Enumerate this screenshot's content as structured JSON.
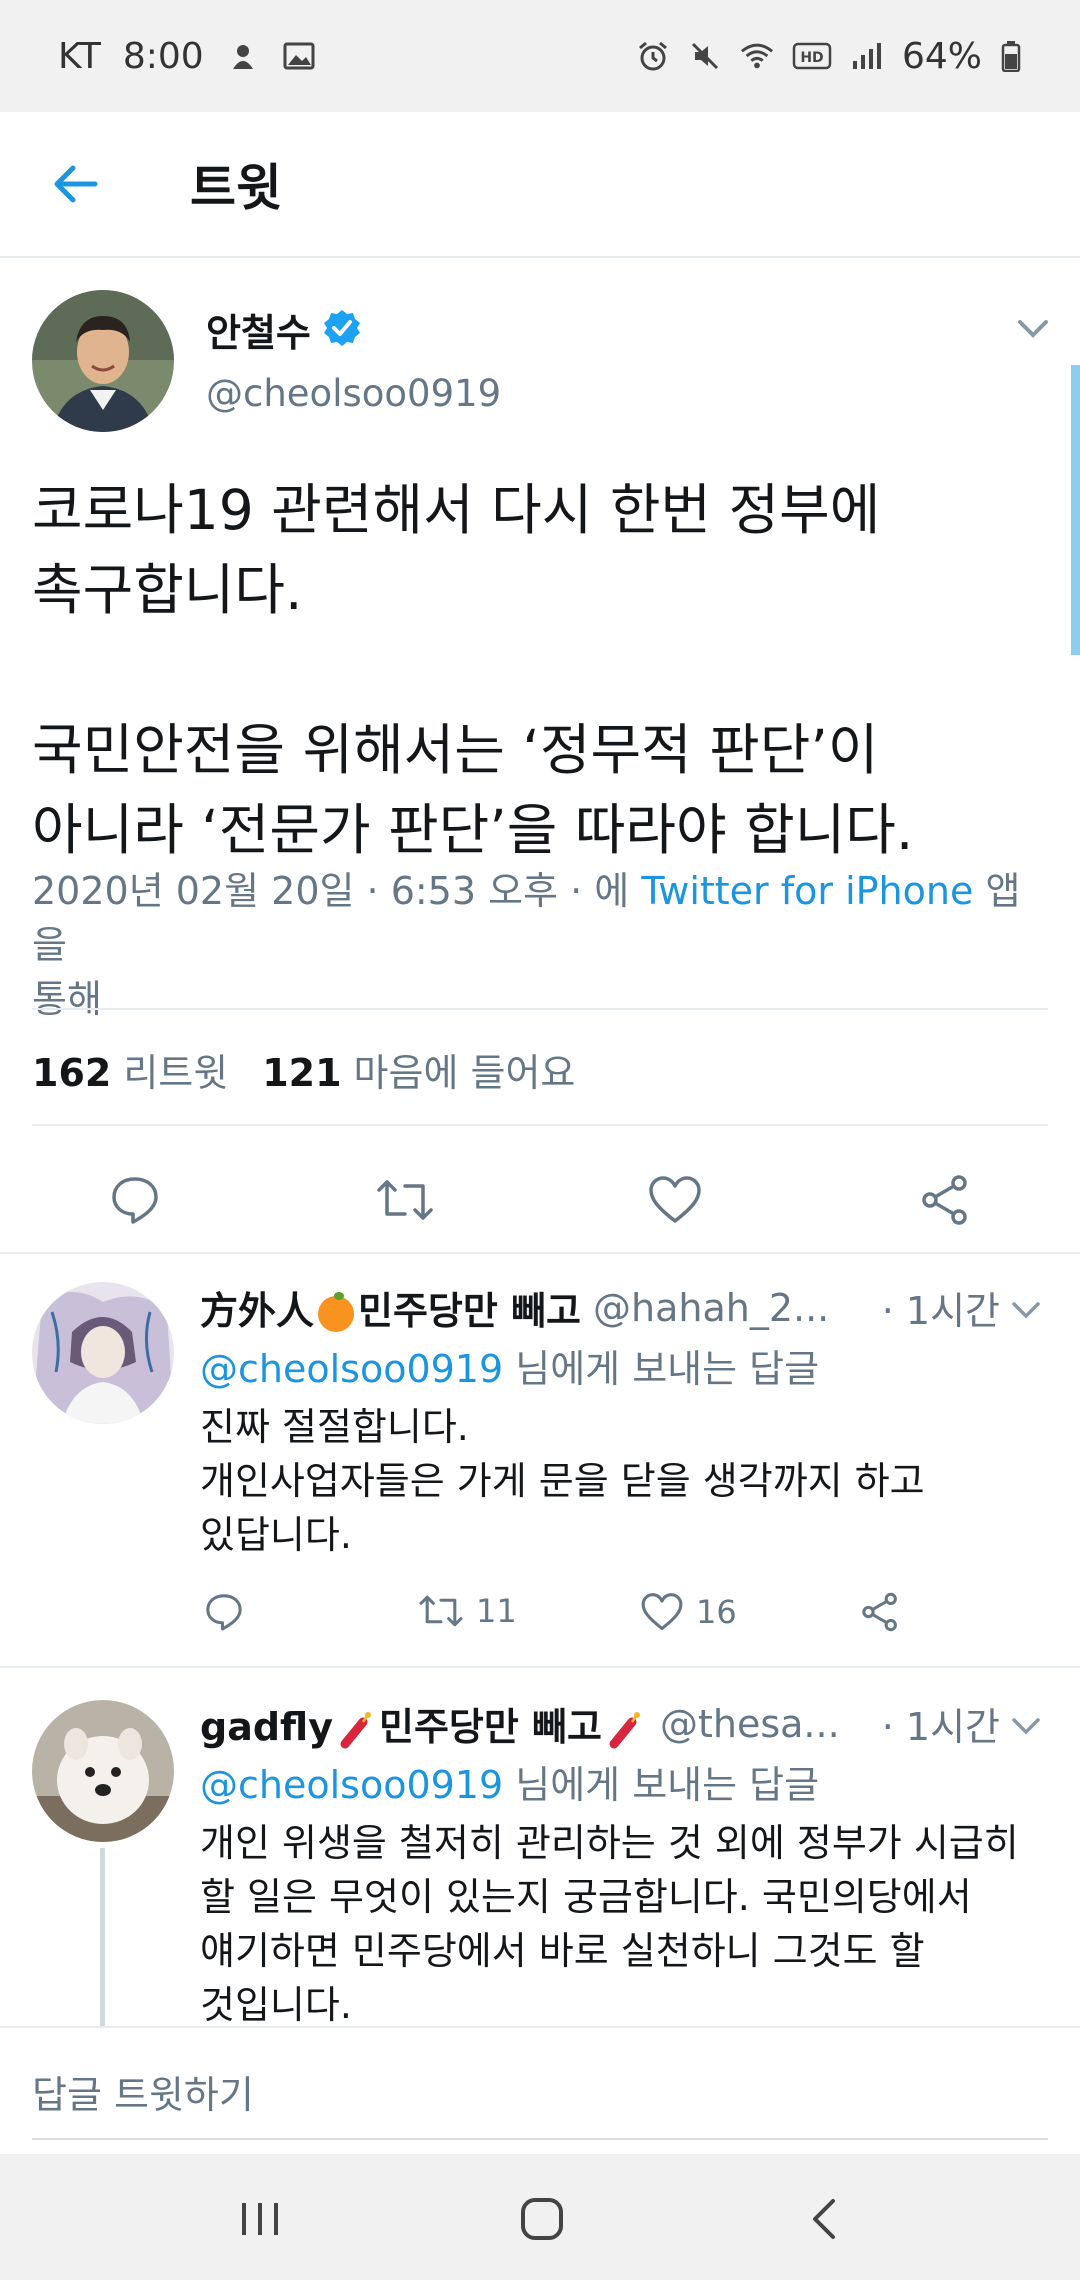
{
  "status_bar": {
    "carrier": "KT",
    "time": "8:00",
    "battery": "64%",
    "left_icons": [
      "notification-icon",
      "gallery-icon"
    ],
    "right_icons": [
      "alarm-icon",
      "mute-icon",
      "wifi-icon",
      "hd-icon",
      "signal-icon",
      "battery-icon"
    ]
  },
  "header": {
    "title": "트윗"
  },
  "tweet": {
    "display_name": "안철수",
    "handle": "@cheolsoo0919",
    "text_lines": [
      "코로나19 관련해서 다시 한번 정부에",
      "촉구합니다.",
      "국민안전을 위해서는 ‘정무적 판단’이",
      "아니라 ‘전문가 판단’을 따라야 합니다."
    ],
    "meta_prefix": "2020년 02월 20일 · 6:53 오후 · 에 ",
    "meta_source": "Twitter for iPhone",
    "meta_suffix": " 앱을",
    "meta_line2": "통해",
    "retweet_count": "162",
    "retweet_label": "리트윗",
    "like_count": "121",
    "like_label": "마음에 들어요"
  },
  "replies": [
    {
      "name_part1": "方外人",
      "name_part2": "민주당만 빼고",
      "handle": "@hahah_2...",
      "time": "· 1시간",
      "reply_to_handle": "@cheolsoo0919",
      "reply_to_suffix": " 님에게 보내는 답글",
      "text_lines": [
        "진짜 절절합니다.",
        "개인사업자들은 가게 문을 닫을 생각까지 하고",
        "있답니다."
      ],
      "retweets": "11",
      "likes": "16"
    },
    {
      "name_part1": "gadfly",
      "name_part2": "민주당만 빼고",
      "handle": "@thesa...",
      "time": "· 1시간",
      "reply_to_handle": "@cheolsoo0919",
      "reply_to_suffix": " 님에게 보내는 답글",
      "text_lines": [
        "개인 위생을 철저히 관리하는 것 외에 정부가 시급히",
        "할 일은 무엇이 있는지 궁금합니다. 국민의당에서",
        "얘기하면 민주당에서 바로 실천하니 그것도 할",
        "것입니다."
      ]
    }
  ],
  "compose": {
    "placeholder": "답글 트윗하기"
  },
  "colors": {
    "accent": "#1b95e0",
    "secondary_text": "#657786",
    "divider": "#e6ecf0"
  }
}
